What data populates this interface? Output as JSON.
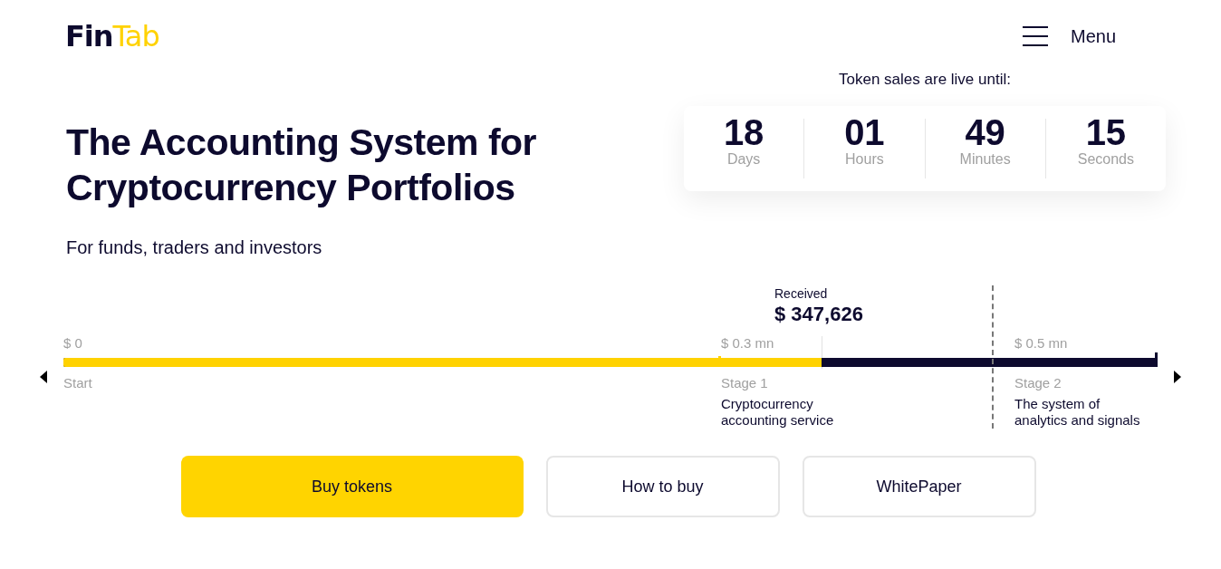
{
  "header": {
    "logo": {
      "part_1": "Fin",
      "part_2": "Tab"
    },
    "menu": {
      "label": "Menu"
    }
  },
  "hero": {
    "title": "The Accounting System for Cryptocurrency Portfolios",
    "subtitle": "For funds, traders and investors"
  },
  "countdown": {
    "caption": "Token sales are live until:",
    "units": [
      {
        "value": "18",
        "label": "Days"
      },
      {
        "value": "01",
        "label": "Hours"
      },
      {
        "value": "49",
        "label": "Minutes"
      },
      {
        "value": "15",
        "label": "Seconds"
      }
    ]
  },
  "progress": {
    "received_label": "Received",
    "received_amount": "$ 347,626",
    "level": 0.693,
    "start": {
      "amount": "$ 0",
      "label": "Start"
    },
    "stages": [
      {
        "amount": "$ 0.3 mn",
        "label": "Stage 1",
        "description": "Cryptocurrency accounting service"
      },
      {
        "amount": "$ 0.5 mn",
        "label": "Stage 2",
        "description": "The system of analytics and signals"
      }
    ]
  },
  "buttons": [
    {
      "label": "Buy tokens",
      "kind": "primary"
    },
    {
      "label": "How to buy",
      "kind": "outline"
    },
    {
      "label": "WhitePaper",
      "kind": "outline"
    }
  ]
}
